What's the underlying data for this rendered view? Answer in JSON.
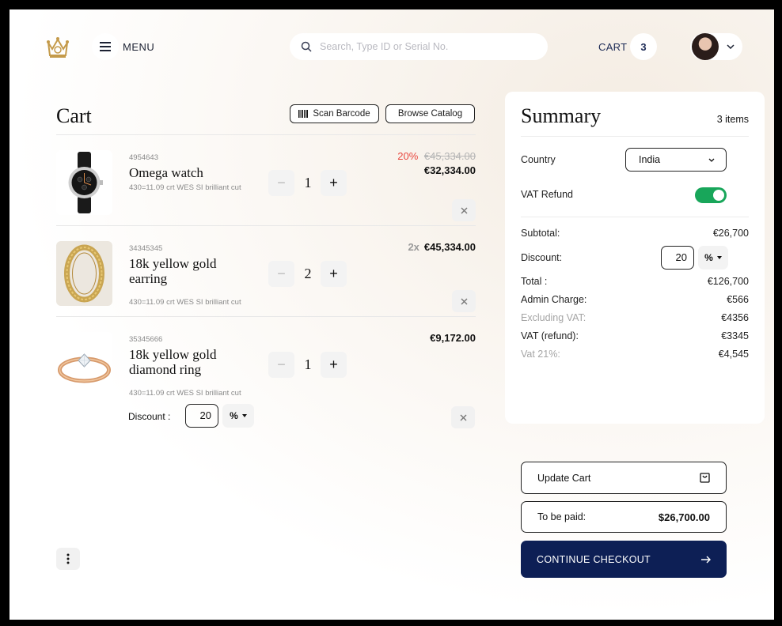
{
  "header": {
    "menu_label": "MENU",
    "search_placeholder": "Search, Type ID or Serial No.",
    "cart_label": "CART",
    "cart_count": "3"
  },
  "cart": {
    "title": "Cart",
    "scan_label": "Scan Barcode",
    "browse_label": "Browse Catalog",
    "items": [
      {
        "sku": "4954643",
        "name": "Omega watch",
        "desc": "430=11.09 crt WES SI brilliant cut",
        "qty": "1",
        "discount_pct": "20%",
        "old_price": "€45,334.00",
        "price": "€32,334.00",
        "multiplier": ""
      },
      {
        "sku": "34345345",
        "name": "18k yellow gold earring",
        "desc": "430=11.09 crt WES SI brilliant cut",
        "qty": "2",
        "discount_pct": "",
        "old_price": "",
        "price": "€45,334.00",
        "multiplier": "2x"
      },
      {
        "sku": "35345666",
        "name": "18k yellow gold diamond ring",
        "desc": "430=11.09 crt WES SI brilliant cut",
        "qty": "1",
        "discount_pct": "",
        "old_price": "",
        "price": "€9,172.00",
        "multiplier": ""
      }
    ],
    "item_discount": {
      "label": "Discount :",
      "value": "20",
      "unit": "%"
    }
  },
  "summary": {
    "title": "Summary",
    "items_count": "3 items",
    "country_label": "Country",
    "country_value": "India",
    "vat_refund_label": "VAT Refund",
    "vat_refund_on": true,
    "subtotal_label": "Subtotal:",
    "subtotal_value": "€26,700",
    "discount_label": "Discount:",
    "discount_value": "20",
    "discount_unit": "%",
    "total_label": "Total :",
    "total_value": "€126,700",
    "admin_label": "Admin Charge:",
    "admin_value": "€566",
    "excl_vat_label": "Excluding VAT:",
    "excl_vat_value": "€4356",
    "vat_refund_amt_label": "VAT (refund):",
    "vat_refund_amt_value": "€3345",
    "vat21_label": "Vat 21%:",
    "vat21_value": "€4,545"
  },
  "actions": {
    "update_cart": "Update Cart",
    "to_be_paid_label": "To be paid:",
    "to_be_paid_value": "$26,700.00",
    "checkout": "CONTINUE CHECKOUT"
  },
  "colors": {
    "accent_navy": "#0d1f55",
    "toggle_green": "#18a65a",
    "discount_red": "#e8473f"
  }
}
